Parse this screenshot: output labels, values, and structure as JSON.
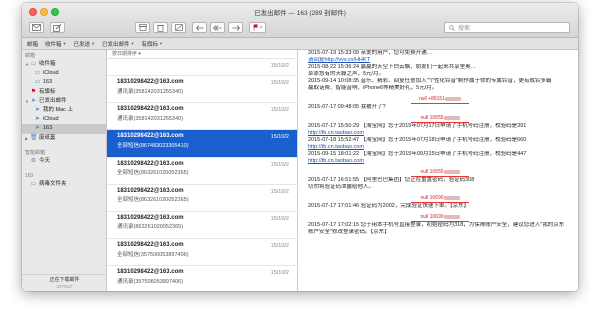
{
  "window": {
    "title": "已发出邮件 — 163 (289 封邮件)"
  },
  "toolbar": {
    "search_placeholder": "搜索"
  },
  "favorites": [
    {
      "label": "邮箱",
      "has_menu": false
    },
    {
      "label": "收件箱",
      "has_menu": true
    },
    {
      "label": "已发送",
      "has_menu": true
    },
    {
      "label": "已发出邮件",
      "has_menu": true
    },
    {
      "label": "有旗标",
      "has_menu": true
    }
  ],
  "sidebar": {
    "header_mailboxes": "邮箱",
    "items": [
      {
        "label": "收件箱",
        "level": 1,
        "expanded": true
      },
      {
        "label": "iCloud",
        "level": 2
      },
      {
        "label": "163",
        "level": 2
      },
      {
        "label": "有旗标",
        "level": 1
      },
      {
        "label": "已发出邮件",
        "level": 1,
        "expanded": true
      },
      {
        "label": "我的 Mac 上",
        "level": 2
      },
      {
        "label": "iCloud",
        "level": 2
      },
      {
        "label": "163",
        "level": 2,
        "selected": true
      },
      {
        "label": "废纸篓",
        "level": 1
      }
    ],
    "header_smart": "智能邮箱",
    "smart_items": [
      {
        "label": "今天"
      }
    ],
    "header_account": "163",
    "account_items": [
      {
        "label": "病毒文件夹"
      }
    ],
    "footer_status": "正在下载邮件",
    "footer_progress": "237/547"
  },
  "list": {
    "sort_label": "按日期排序 ▾",
    "messages": [
      {
        "from": "",
        "subject": "",
        "date": "15/10/2",
        "selected": false
      },
      {
        "from": "18310298422@163.com",
        "subject": "通讯录(358142031255340)",
        "date": "15/10/2",
        "selected": false
      },
      {
        "from": "18310298422@163.com",
        "subject": "通讯录(358142031255340)",
        "date": "15/10/2",
        "selected": false
      },
      {
        "from": "18310298422@163.com",
        "subject": "全部短信(867483023305410)",
        "date": "15/10/2",
        "selected": true
      },
      {
        "from": "18310298422@163.com",
        "subject": "全部短信(863261020052365)",
        "date": "15/10/2",
        "selected": false
      },
      {
        "from": "18310298422@163.com",
        "subject": "全部短信(863261020052365)",
        "date": "15/10/2",
        "selected": false
      },
      {
        "from": "18310298422@163.com",
        "subject": "通讯录(863261020052365)",
        "date": "15/10/2",
        "selected": false
      },
      {
        "from": "18310298422@163.com",
        "subject": "全部短信(357506053897406)",
        "date": "15/10/2",
        "selected": false
      },
      {
        "from": "18310298422@163.com",
        "subject": "通讯录(357506053897406)",
        "date": "15/10/2",
        "selected": false
      }
    ]
  },
  "reading": {
    "block1": [
      "2015-07-19 15:33:09 亲爱的用户，您可免费开通…",
      "请回复http://vvv.cn/HHKT",
      "2015-08-22 15:36:24 赢赢的天空下白云飘，朋友们一起来共享里奥…",
      "草原悠有的天籁之声，5元/月。",
      "2015-09-14 10:08:35 音乐、精彩、回复任意加入\"个性化铃音\"制作属于你的专属铃音，更有成铃多霸",
      "赢取话费、智能音响、iPhone6等精美好礼，5元/月。"
    ],
    "block2": {
      "sender": "null +86151",
      "lines": [
        "2015-07-17 09:48:05 我被开了?"
      ]
    },
    "block3": {
      "sender": "null 10655",
      "lines": [
        "2015-07-17 15:50:29 【淘宝网】您于2015年07月17日申请了手机号码注册，校验码是391",
        "http://tb.cn.taobao.com",
        "2015-07-18 15:52:47 【淘宝网】您于2015年07月18日申请了手机号码注册，校验码是660",
        "http://tb.cn.taobao.com",
        "2015-09-15 18:01:22 【淘宝网】您于2015年09月15日申请了手机号码注册，校验码是447",
        "http://tb.cn.taobao.com"
      ]
    },
    "block4": {
      "sender": "null 10655",
      "lines": [
        "2015-07-17 16:51:55 【阿里巴巴集团】您正在重置密码，验证码308",
        "切勿将验证码泄露给他人。"
      ]
    },
    "block5": {
      "sender": "null 10690",
      "lines": [
        "2015-07-17 17:01:46 验证码为2002，完成验证快速下单。【京东】"
      ]
    },
    "block6": {
      "sender": "null 10690",
      "lines": [
        "2015-07-17 17:02:15 您于用本手机号直接登录，初始密码为318，为保障账户安全，建议您进入\"我的京东",
        "账户安全\"修改登录密码。【京东】"
      ]
    }
  },
  "colors": {
    "selection": "#1a5fce",
    "link": "#1d4fb8",
    "red_separator": "#e03a3a",
    "flag": "#d0021b"
  }
}
